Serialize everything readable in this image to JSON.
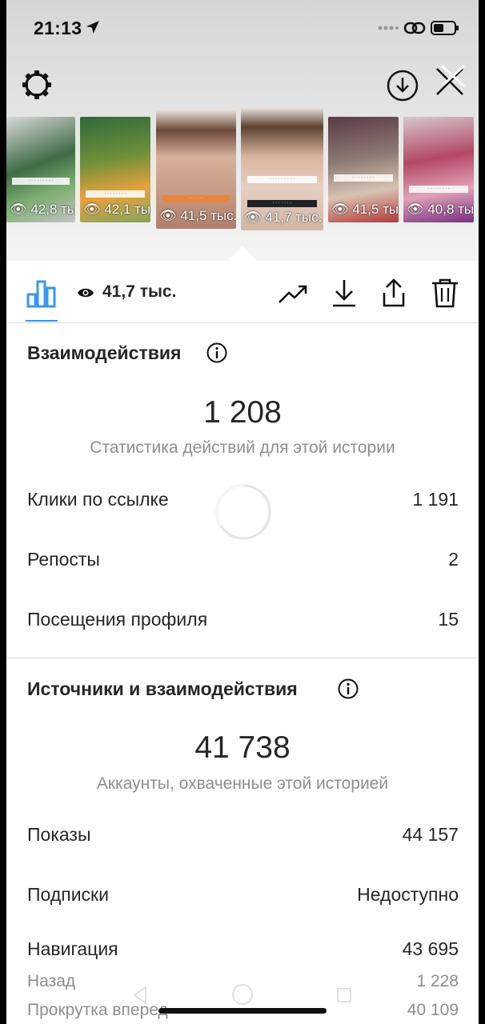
{
  "status_bar": {
    "time": "21:13"
  },
  "stories": [
    {
      "views": "42,8 тыс.",
      "color": "#3f6b45"
    },
    {
      "views": "42,1 тыс.",
      "color": "#6f8f3a"
    },
    {
      "views": "41,5 тыс.",
      "color": "#b98a6e"
    },
    {
      "views": "41,7 тыс.",
      "color": "#c9a48c"
    },
    {
      "views": "41,5 тыс.",
      "color": "#8e7a74"
    },
    {
      "views": "40,8 тыс.",
      "color": "#b34866"
    }
  ],
  "toolbar": {
    "views_total": "41,7 тыс."
  },
  "interactions": {
    "title": "Взаимодействия",
    "total": "1 208",
    "subtitle": "Статистика действий для этой истории",
    "rows": [
      {
        "label": "Клики по ссылке",
        "value": "1 191"
      },
      {
        "label": "Репосты",
        "value": "2"
      },
      {
        "label": "Посещения профиля",
        "value": "15"
      }
    ]
  },
  "discovery": {
    "title": "Источники и взаимодействия",
    "total": "41 738",
    "subtitle": "Аккаунты, охваченные этой историей",
    "rows": [
      {
        "label": "Показы",
        "value": "44 157"
      },
      {
        "label": "Подписки",
        "value": "Недоступно"
      },
      {
        "label": "Навигация",
        "value": "43 695"
      },
      {
        "label": "Назад",
        "value": "1 228"
      },
      {
        "label": "Прокрутка вперед",
        "value": "40 109"
      }
    ]
  },
  "colors": {
    "accent": "#3897f0",
    "text": "#262626",
    "secondary": "#8e8e8e"
  }
}
